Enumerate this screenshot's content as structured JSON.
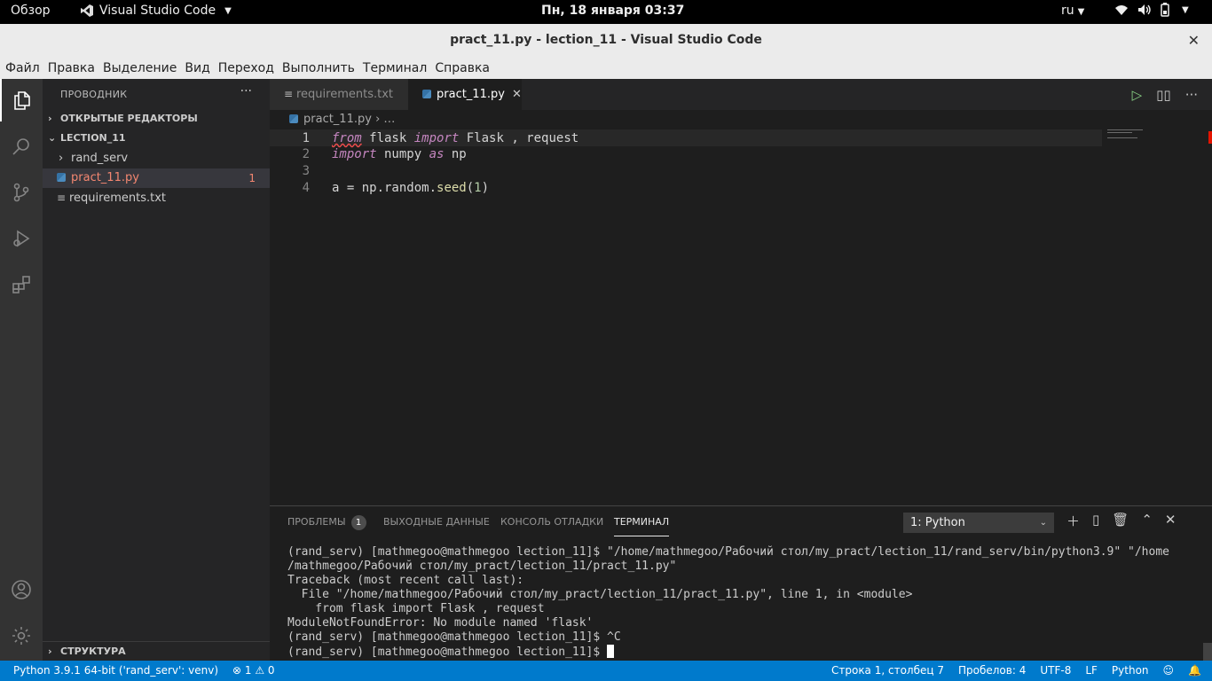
{
  "system_bar": {
    "overview": "Обзор",
    "app_name": "Visual Studio Code",
    "clock": "Пн, 18 января  03:37",
    "lang": "ru"
  },
  "window": {
    "title": "pract_11.py - lection_11 - Visual Studio Code",
    "close": "✕"
  },
  "menu": [
    "Файл",
    "Правка",
    "Выделение",
    "Вид",
    "Переход",
    "Выполнить",
    "Терминал",
    "Справка"
  ],
  "sidebar": {
    "title": "ПРОВОДНИК",
    "more": "···",
    "open_editors": "ОТКРЫТЫЕ РЕДАКТОРЫ",
    "folder": "LECTION_11",
    "items": [
      {
        "label": "rand_serv",
        "kind": "folder"
      },
      {
        "label": "pract_11.py",
        "kind": "python",
        "badge": "1"
      },
      {
        "label": "requirements.txt",
        "kind": "text"
      }
    ],
    "structure": "СТРУКТУРА"
  },
  "tabs": [
    {
      "label": "requirements.txt"
    },
    {
      "label": "pract_11.py",
      "close": "✕"
    }
  ],
  "breadcrumb": {
    "file": "pract_11.py",
    "rest": "…"
  },
  "code": {
    "line_numbers": [
      "1",
      "2",
      "3",
      "4"
    ],
    "l1": {
      "from": "from",
      "mod": " flask ",
      "imp": "import",
      "rest": " Flask , request"
    },
    "l2": {
      "imp": "import",
      "mod": " numpy ",
      "as": "as",
      "rest": " np"
    },
    "l4": {
      "pre": "a = np.random.",
      "fn": "seed",
      "open": "(",
      "num": "1",
      "close": ")"
    }
  },
  "panel": {
    "tabs": {
      "problems": "ПРОБЛЕМЫ",
      "problems_count": "1",
      "output": "ВЫХОДНЫЕ ДАННЫЕ",
      "debug": "КОНСОЛЬ ОТЛАДКИ",
      "terminal": "ТЕРМИНАЛ"
    },
    "terminal_select": "1: Python",
    "terminal_lines": [
      "(rand_serv) [mathmegoo@mathmegoo lection_11]$ \"/home/mathmegoo/Рабочий стол/my_pract/lection_11/rand_serv/bin/python3.9\" \"/home",
      "/mathmegoo/Рабочий стол/my_pract/lection_11/pract_11.py\"",
      "Traceback (most recent call last):",
      "  File \"/home/mathmegoo/Рабочий стол/my_pract/lection_11/pract_11.py\", line 1, in <module>",
      "    from flask import Flask , request",
      "ModuleNotFoundError: No module named 'flask'",
      "(rand_serv) [mathmegoo@mathmegoo lection_11]$ ^C",
      "(rand_serv) [mathmegoo@mathmegoo lection_11]$ "
    ]
  },
  "status": {
    "interpreter": "Python 3.9.1 64-bit ('rand_serv': venv)",
    "errors": "⊗ 1 ⚠ 0",
    "position": "Строка 1, столбец 7",
    "spaces": "Пробелов: 4",
    "encoding": "UTF-8",
    "eol": "LF",
    "language": "Python"
  }
}
